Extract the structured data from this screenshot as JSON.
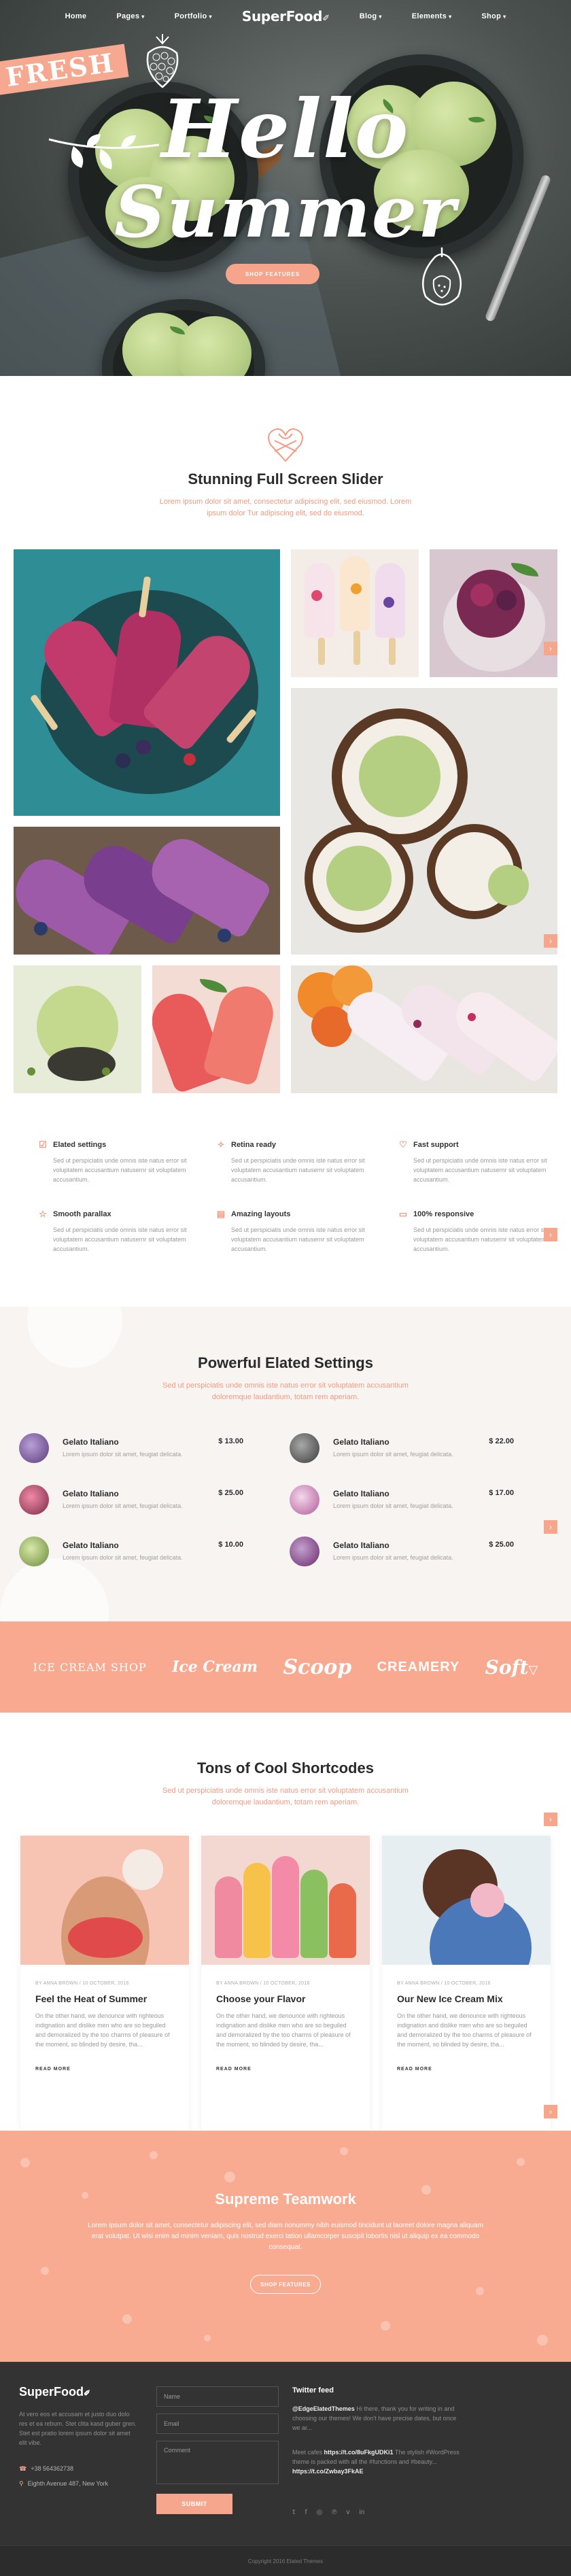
{
  "nav": {
    "items_left": [
      "Home",
      "Pages",
      "Portfolio"
    ],
    "logo": "SuperFood",
    "items_right": [
      "Blog",
      "Elements",
      "Shop"
    ]
  },
  "hero": {
    "badge": "FRESH",
    "title_line1": "Hello",
    "title_line2": "Summer",
    "button": "SHOP FEATURES"
  },
  "slider_section": {
    "title": "Stunning Full Screen Slider",
    "subtitle": "Lorem ipsum dolor sit amet, consectetur adipiscing elit, sed eiusmod. Lorem ipsum dolor Tur adipiscing elit, sed do eiusmod."
  },
  "features": [
    {
      "icon": "check-square-icon",
      "title": "Elated settings",
      "text": "Sed ut perspiciatis unde omnis iste natus error sit voluptatem accusantium natusernr sit voluptatem accusantium."
    },
    {
      "icon": "bulb-icon",
      "title": "Retina ready",
      "text": "Sed ut perspiciatis unde omnis iste natus error sit voluptatem accusantium natusernr sit voluptatem accusantium."
    },
    {
      "icon": "heart-icon",
      "title": "Fast support",
      "text": "Sed ut perspiciatis unde omnis iste natus error sit voluptatem accusantium natusernr sit voluptatem accusantium."
    },
    {
      "icon": "star-icon",
      "title": "Smooth parallax",
      "text": "Sed ut perspiciatis unde omnis iste natus error sit voluptatem accusantium natusernr sit voluptatem accusantium."
    },
    {
      "icon": "layout-icon",
      "title": "Amazing layouts",
      "text": "Sed ut perspiciatis unde omnis iste natus error sit voluptatem accusantium natusernr sit voluptatem accusantium."
    },
    {
      "icon": "percent-icon",
      "title": "100% responsive",
      "text": "Sed ut perspiciatis unde omnis iste natus error sit voluptatem accusantium natusernr sit voluptatem accusantium."
    }
  ],
  "menu_section": {
    "title": "Powerful Elated Settings",
    "subtitle": "Sed ut perspiciatis unde omnis iste natus error sit voluptatem accusantium doloremque laudantium, totam rem aperiam.",
    "items": [
      {
        "name": "Gelato Italiano",
        "desc": "Lorem ipsum dolor sit amet, feugiat delicata.",
        "price": "$ 13.00"
      },
      {
        "name": "Gelato Italiano",
        "desc": "Lorem ipsum dolor sit amet, feugiat delicata.",
        "price": "$ 22.00"
      },
      {
        "name": "Gelato Italiano",
        "desc": "Lorem ipsum dolor sit amet, feugiat delicata.",
        "price": "$ 25.00"
      },
      {
        "name": "Gelato Italiano",
        "desc": "Lorem ipsum dolor sit amet, feugiat delicata.",
        "price": "$ 17.00"
      },
      {
        "name": "Gelato Italiano",
        "desc": "Lorem ipsum dolor sit amet, feugiat delicata.",
        "price": "$ 10.00"
      },
      {
        "name": "Gelato Italiano",
        "desc": "Lorem ipsum dolor sit amet, feugiat delicata.",
        "price": "$ 25.00"
      }
    ]
  },
  "brands": [
    "ICE CREAM SHOP",
    "Ice Cream",
    "Scoop",
    "CREAMERY",
    "Soft"
  ],
  "blog_section": {
    "title": "Tons of Cool Shortcodes",
    "subtitle": "Sed ut perspiciatis unde omnis iste natus error sit voluptatem accusantium doloremque laudantium, totam rem aperiam.",
    "posts": [
      {
        "meta": "BY ANNA BROWN  /  10 OCTOBER, 2016",
        "title": "Feel the Heat of Summer",
        "excerpt": "On the other hand, we denounce with righteous indignation and dislike men who are so beguiled and demoralized by the too charms of pleasure of the moment, so blinded by desire, tha...",
        "more": "READ MORE"
      },
      {
        "meta": "BY ANNA BROWN  /  10 OCTOBER, 2016",
        "title": "Choose your Flavor",
        "excerpt": "On the other hand, we denounce with righteous indignation and dislike men who are so beguiled and demoralized by the too charms of pleasure of the moment, so blinded by desire, tha...",
        "more": "READ MORE"
      },
      {
        "meta": "BY ANNA BROWN  /  10 OCTOBER, 2016",
        "title": "Our New Ice Cream Mix",
        "excerpt": "On the other hand, we denounce with righteous indignation and dislike men who are so beguiled and demoralized by the too charms of pleasure of the moment, so blinded by desire, tha...",
        "more": "READ MORE"
      }
    ]
  },
  "team_section": {
    "title": "Supreme Teamwork",
    "text": "Lorem ipsum dolor sit amet, consectetur adipiscing elit, sed diam nonummy nibh euismod tincidunt ut laoreet dolore magna aliquam erat volutpat. Ut wisi enim ad minim veniam, quis nostrud exerci tation ullamcorper suscipit lobortis nisl ut aliquip ex ea commodo consequat.",
    "button": "SHOP FEATURES"
  },
  "footer": {
    "logo": "SuperFood",
    "about": "At vero eos et accusam et justo duo dolo res et ea rebum. Stet clita kasd guber gren. Stet est pratio lorem ipsum dolor sit amet elit vibe.",
    "phone": "+38 564362738",
    "address": "Eighth Avenue 487, New York",
    "name_placeholder": "Name",
    "email_placeholder": "Email",
    "comment_placeholder": "Comment",
    "submit": "SUBMIT",
    "twitter_title": "Twitter feed",
    "tweets": [
      {
        "handle": "@EdgeElatedThemes",
        "text": " Hi there, thank you for writing in and choosing our themes! We don't have precise dates, but once we ar..."
      },
      {
        "handle": "",
        "text": "Meet cafes ",
        "link": "https://t.co/8uFkgUDKi1",
        "rest": " The stylish #WordPress theme is packed with all the #functions and #beauty... ",
        "link2": "https://t.co/Zwbay3FkAE"
      }
    ],
    "socials": [
      "twitter-icon",
      "facebook-icon",
      "instagram-icon",
      "pinterest-icon",
      "linkedin-icon"
    ],
    "copyright": "Copyright 2016 Elated Themes"
  },
  "colors": {
    "accent": "#f5a68d",
    "dark": "#333333",
    "menu_bg": "#f7f4f1"
  }
}
